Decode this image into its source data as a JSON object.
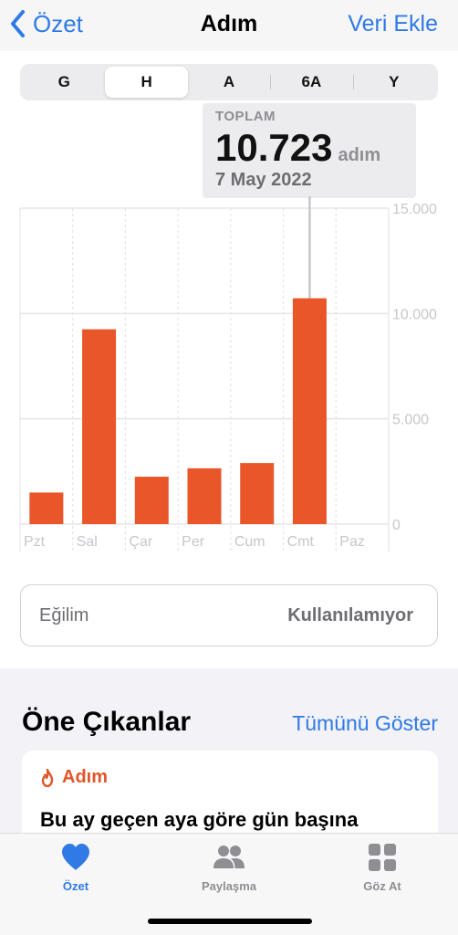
{
  "nav": {
    "back_label": "Özet",
    "title": "Adım",
    "action_label": "Veri Ekle"
  },
  "segments": [
    {
      "label": "G",
      "active": false
    },
    {
      "label": "H",
      "active": true
    },
    {
      "label": "A",
      "active": false
    },
    {
      "label": "6A",
      "active": false
    },
    {
      "label": "Y",
      "active": false
    }
  ],
  "tooltip": {
    "label": "TOPLAM",
    "value": "10.723",
    "unit": "adım",
    "date": "7 May 2022"
  },
  "chart_data": {
    "type": "bar",
    "categories": [
      "Pzt",
      "Sal",
      "Çar",
      "Per",
      "Cum",
      "Cmt",
      "Paz"
    ],
    "values": [
      1500,
      9250,
      2250,
      2650,
      2900,
      10723,
      0
    ],
    "ylim": [
      0,
      15000
    ],
    "yticks": [
      0,
      5000,
      10000,
      15000
    ],
    "ytick_labels": [
      "0",
      "5.000",
      "10.000",
      "15.000"
    ],
    "highlighted_index": 5,
    "bar_color": "#e8562a",
    "grid": true
  },
  "trend": {
    "label": "Eğilim",
    "value": "Kullanılamıyor"
  },
  "highlights": {
    "title": "Öne Çıkanlar",
    "show_all_label": "Tümünü Göster",
    "card": {
      "category": "Adım",
      "icon": "flame-icon",
      "text": "Bu ay geçen aya göre gün başına"
    }
  },
  "tabbar": {
    "items": [
      {
        "label": "Özet",
        "icon": "heart-icon",
        "active": true
      },
      {
        "label": "Paylaşma",
        "icon": "people-icon",
        "active": false
      },
      {
        "label": "Göz At",
        "icon": "grid-icon",
        "active": false
      }
    ]
  },
  "colors": {
    "accent": "#2f7ae5",
    "bar": "#e8562a",
    "flame": "#e1552a"
  }
}
